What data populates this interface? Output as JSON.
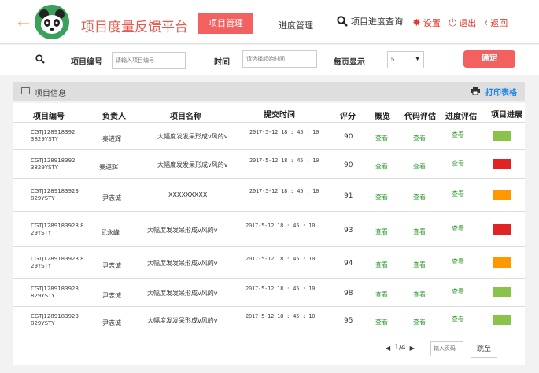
{
  "header": {
    "title": "项目度量反馈平台",
    "nav_active": "项目管理",
    "nav_progress": "进度管理",
    "search_link": "项目进度查询",
    "settings": "设置",
    "logout": "退出",
    "back": "返回"
  },
  "filter": {
    "project_no_label": "项目编号",
    "project_no_placeholder": "请输入项目编号",
    "time_label": "时间",
    "time_placeholder": "请选择起始时间",
    "per_page_label": "每页显示",
    "per_page_value": "5",
    "confirm": "确定"
  },
  "infobar": {
    "label": "项目信息",
    "print": "打印表格"
  },
  "table": {
    "headers": [
      "项目编号",
      "负责人",
      "项目名称",
      "提交时间",
      "评分",
      "概览",
      "代码评估",
      "进度评估",
      "项目进展"
    ],
    "view_label": "查看",
    "rows": [
      {
        "id": "CGTJ128918392\n3829YSTY",
        "person": "秦进辉",
        "name": "大幅度发发呆形成v风的v",
        "time": "2017-5-12  18 : 45 : 10",
        "score": "90",
        "status_color": "#8bc34a"
      },
      {
        "id": "CGTJ128918392\n3829YSTY",
        "person": "秦进辉",
        "name": "大幅度发发呆形成v风的v",
        "time": "2017-5-12  18 : 45 : 10",
        "score": "90",
        "status_color": "#e02424"
      },
      {
        "id": "CGTJ1289183923\n829YSTY",
        "person": "尹志诚",
        "name": "XXXXXXXXX",
        "time": "2017-5-12  18 : 45 : 10",
        "score": "91",
        "status_color": "#ff9800"
      },
      {
        "id": "CGTJ1289183923 8\n29YSTY",
        "person": "武永峰",
        "name": "大幅度发发呆形成v风的v",
        "time": "2017-5-12  18 : 45 : 10",
        "score": "93",
        "status_color": "#e02424"
      },
      {
        "id": "CGTJ1289183923 8\n29YSTY",
        "person": "尹志诚",
        "name": "大幅度发发呆形成v风的v",
        "time": "2017-5-12  18 : 45 : 10",
        "score": "94",
        "status_color": "#ff9800"
      },
      {
        "id": "CGTJ1289183923\n829YSTY",
        "person": "尹志诚",
        "name": "大幅度发发呆形成v风的v",
        "time": "2017-5-12  18 : 45 : 10",
        "score": "98",
        "status_color": "#8bc34a"
      },
      {
        "id": "CGTJ1289183923\n829YSTY",
        "person": "尹志诚",
        "name": "大幅度发发呆形成v风的v",
        "time": "2017-5-12  18 : 45 : 10",
        "score": "95",
        "status_color": "#8bc34a"
      }
    ]
  },
  "pager": {
    "page": "1/4",
    "input_placeholder": "输入页码",
    "go": "跳至"
  }
}
